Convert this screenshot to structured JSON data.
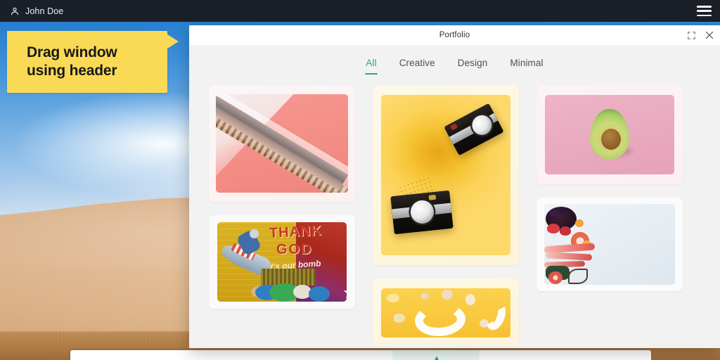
{
  "topbar": {
    "user_icon": "user-icon",
    "user_name": "John Doe",
    "menu_icon": "hamburger-menu-icon"
  },
  "callout": {
    "text": "Drag window\nusing header"
  },
  "window": {
    "title": "Portfolio",
    "maximize_icon": "maximize-icon",
    "close_icon": "close-icon",
    "tabs": [
      {
        "label": "All",
        "active": true
      },
      {
        "label": "Creative",
        "active": false
      },
      {
        "label": "Design",
        "active": false
      },
      {
        "label": "Minimal",
        "active": false
      }
    ],
    "gallery": {
      "columns": [
        {
          "items": [
            {
              "alt": "Escalator steps on salmon pink background"
            },
            {
              "alt": "Street art mural reading THANK GOD it's our bomb"
            }
          ]
        },
        {
          "items": [
            {
              "alt": "Two vintage film cameras on yellow background"
            },
            {
              "alt": "Coconut pieces and fruit on yellow background"
            }
          ]
        },
        {
          "items": [
            {
              "alt": "Halved avocado on pink background"
            },
            {
              "alt": "Fruit and vegetable flatlay on white background"
            }
          ]
        }
      ]
    }
  },
  "mural_text": {
    "thank": "THANK",
    "god": "GOD",
    "script": "it's our bomb"
  },
  "bottom_sheet": {
    "icon": "leaf-icon"
  },
  "colors": {
    "accent": "#26A69A",
    "callout_bg": "#FADA54",
    "topbar_bg": "#1B1F27",
    "window_bg": "#F2F2F2",
    "header_bg": "#FFFFFF",
    "desk": "#B9854F",
    "sky": "#3D8FDA",
    "sand": "#E3BC95"
  }
}
